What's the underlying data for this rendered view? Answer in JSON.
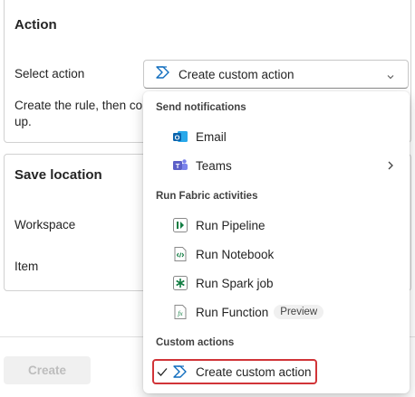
{
  "action_card": {
    "title": "Action",
    "select_label": "Select action",
    "selected_value": "Create custom action",
    "description_line1": "Create the rule, then co",
    "description_line2": "up."
  },
  "save_card": {
    "title": "Save location",
    "workspace_label": "Workspace",
    "item_label": "Item"
  },
  "footer": {
    "create_label": "Create"
  },
  "menu": {
    "groups": [
      {
        "header": "Send notifications"
      },
      {
        "header": "Run Fabric activities"
      },
      {
        "header": "Custom actions"
      }
    ],
    "items": [
      {
        "label": "Email",
        "icon": "outlook-icon"
      },
      {
        "label": "Teams",
        "icon": "teams-icon"
      },
      {
        "label": "Run Pipeline",
        "icon": "pipeline-icon"
      },
      {
        "label": "Run Notebook",
        "icon": "notebook-icon"
      },
      {
        "label": "Run Spark job",
        "icon": "spark-job-icon"
      },
      {
        "label": "Run Function",
        "icon": "function-icon",
        "badge": "Preview"
      },
      {
        "label": "Create custom action",
        "icon": "custom-action-icon",
        "selected": true
      }
    ]
  },
  "colors": {
    "accent_blue": "#0f6cbd",
    "selection_outline": "#d13438",
    "teams_purple": "#5b5fc7",
    "fabric_green": "#107c41"
  }
}
